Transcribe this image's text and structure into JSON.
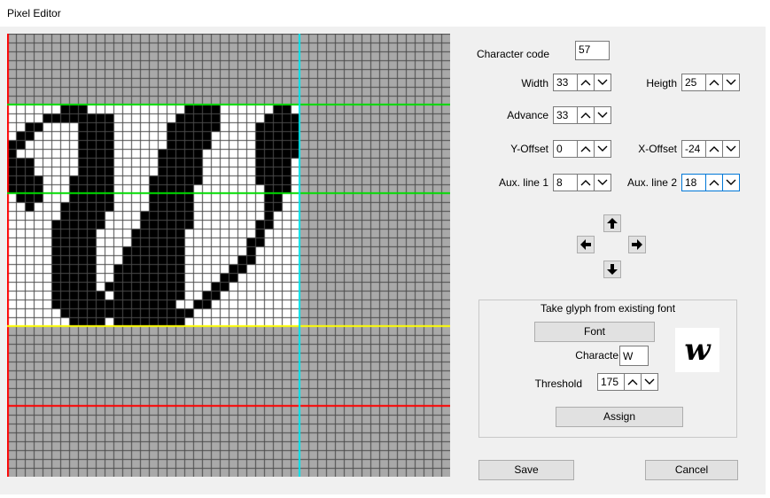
{
  "window": {
    "title": "Pixel Editor"
  },
  "fields": {
    "character_code": {
      "label": "Character code",
      "value": "57"
    },
    "width": {
      "label": "Width",
      "value": "33"
    },
    "height": {
      "label": "Heigth",
      "value": "25"
    },
    "advance": {
      "label": "Advance",
      "value": "33"
    },
    "y_offset": {
      "label": "Y-Offset",
      "value": "0"
    },
    "x_offset": {
      "label": "X-Offset",
      "value": "-24"
    },
    "aux1": {
      "label": "Aux. line 1",
      "value": "8"
    },
    "aux2": {
      "label": "Aux. line 2",
      "value": "18"
    }
  },
  "glyph_group": {
    "title": "Take glyph from existing font",
    "font_button": "Font",
    "character_label": "Characte",
    "character_value": "W",
    "threshold_label": "Threshold",
    "threshold_value": "175",
    "assign_button": "Assign",
    "preview_glyph": "w"
  },
  "buttons": {
    "save": "Save",
    "cancel": "Cancel"
  },
  "editor": {
    "grid_cols": 50,
    "grid_rows": 50,
    "glyph_columns": 33,
    "glyph_rows": 25,
    "colors": {
      "background": "#a9a9a9",
      "glyph_area": "#ffffff",
      "grid_line": "#4a4a4a",
      "pixel_on": "#000000",
      "border_line": "#ff0000",
      "advance_line": "#00e5ee",
      "aux_line": "#00dd00",
      "baseline": "#ffff00"
    }
  }
}
